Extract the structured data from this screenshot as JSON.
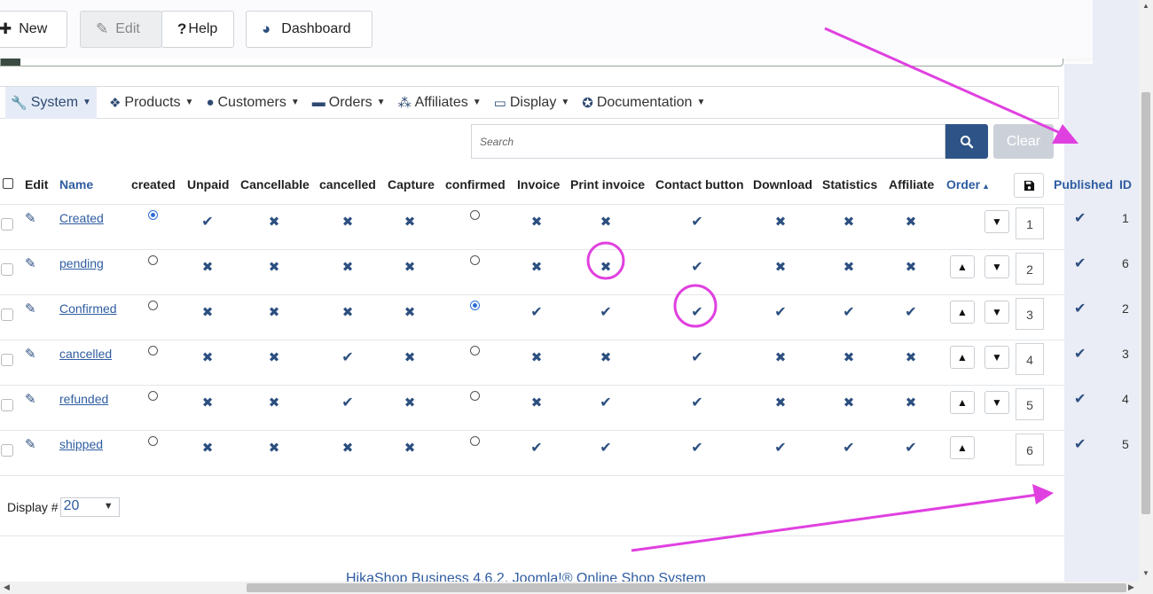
{
  "toolbar": {
    "new_label": "New",
    "edit_label": "Edit",
    "help_label": "Help",
    "dashboard_label": "Dashboard"
  },
  "menu": [
    {
      "label": "System",
      "icon": "wrench-icon"
    },
    {
      "label": "Products",
      "icon": "cubes-icon"
    },
    {
      "label": "Customers",
      "icon": "user-icon"
    },
    {
      "label": "Orders",
      "icon": "credit-card-icon"
    },
    {
      "label": "Affiliates",
      "icon": "users-icon"
    },
    {
      "label": "Display",
      "icon": "monitor-icon"
    },
    {
      "label": "Documentation",
      "icon": "lifebuoy-icon"
    }
  ],
  "search": {
    "placeholder": "Search",
    "clear_label": "Clear"
  },
  "table": {
    "headers": {
      "edit": "Edit",
      "name": "Name",
      "created": "created",
      "unpaid": "Unpaid",
      "cancellable": "Cancellable",
      "cancelled": "cancelled",
      "capture": "Capture",
      "confirmed": "confirmed",
      "invoice": "Invoice",
      "print_invoice": "Print invoice",
      "contact_button": "Contact button",
      "download": "Download",
      "statistics": "Statistics",
      "affiliate": "Affiliate",
      "order": "Order",
      "published": "Published",
      "id": "ID"
    },
    "rows": [
      {
        "name": "Created",
        "created": true,
        "flags": [
          1,
          0,
          0,
          0
        ],
        "confirmed": false,
        "flags2": [
          0,
          0,
          1,
          0,
          0,
          0
        ],
        "order": "1",
        "id": "1"
      },
      {
        "name": "pending",
        "created": false,
        "flags": [
          0,
          0,
          0,
          0
        ],
        "confirmed": false,
        "flags2": [
          0,
          0,
          1,
          0,
          0,
          0
        ],
        "order": "2",
        "id": "6"
      },
      {
        "name": "Confirmed",
        "created": false,
        "flags": [
          0,
          0,
          0,
          0
        ],
        "confirmed": true,
        "flags2": [
          1,
          1,
          1,
          1,
          1,
          1
        ],
        "order": "3",
        "id": "2"
      },
      {
        "name": "cancelled",
        "created": false,
        "flags": [
          0,
          0,
          1,
          0
        ],
        "confirmed": false,
        "flags2": [
          0,
          0,
          1,
          0,
          0,
          0
        ],
        "order": "4",
        "id": "3"
      },
      {
        "name": "refunded",
        "created": false,
        "flags": [
          0,
          0,
          1,
          0
        ],
        "confirmed": false,
        "flags2": [
          0,
          1,
          1,
          0,
          0,
          0
        ],
        "order": "5",
        "id": "4"
      },
      {
        "name": "shipped",
        "created": false,
        "flags": [
          0,
          0,
          0,
          0
        ],
        "confirmed": false,
        "flags2": [
          1,
          1,
          1,
          1,
          1,
          1
        ],
        "order": "6",
        "id": "5"
      }
    ]
  },
  "display": {
    "label": "Display #",
    "value": "20"
  },
  "footer": {
    "text": "HikaShop Business 4.6.2, Joomla!® Online Shop System"
  },
  "annotation_color": "#e040e0"
}
